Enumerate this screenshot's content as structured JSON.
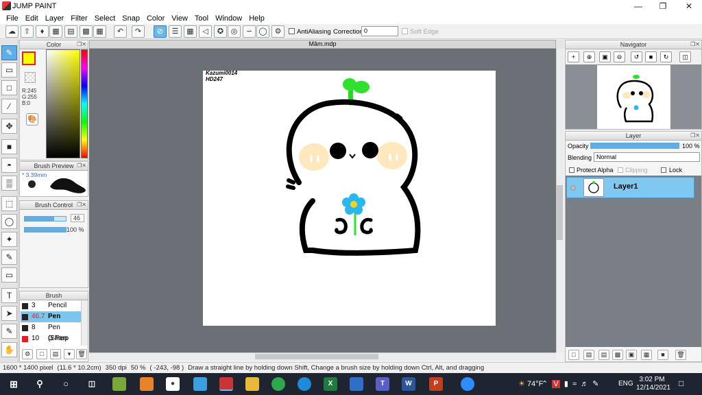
{
  "app": {
    "title": "JUMP PAINT"
  },
  "menu": [
    "File",
    "Edit",
    "Layer",
    "Filter",
    "Select",
    "Snap",
    "Color",
    "View",
    "Tool",
    "Window",
    "Help"
  ],
  "toolbar": {
    "antialiasing_label": "AntiAliasing",
    "correction_label": "Correction",
    "correction_value": "0",
    "soft_edge_label": "Soft Edge"
  },
  "color_panel": {
    "title": "Color",
    "fg_color": "#f5ff00",
    "r": "R:245",
    "g": "G:255",
    "b": "B:0"
  },
  "brush_preview": {
    "title": "Brush Preview",
    "size": "* 3.39mm"
  },
  "brush_control": {
    "title": "Brush Control",
    "size_value": "46",
    "opacity_value": "100 %",
    "size_fraction": 0.72,
    "opacity_fraction": 1.0
  },
  "brush_list": {
    "title": "Brush",
    "items": [
      {
        "size": "3",
        "name": "Pencil",
        "selected": false
      },
      {
        "size": "46.7",
        "name": "Pen",
        "selected": true
      },
      {
        "size": "8",
        "name": "Pen (Sharp",
        "selected": false
      },
      {
        "size": "10",
        "name": "G Pen",
        "selected": false
      }
    ]
  },
  "canvas": {
    "tab_title": "Mâm.mdp",
    "signature_line1": "Kazumi0014",
    "signature_line2": "HD247"
  },
  "navigator": {
    "title": "Navigator"
  },
  "layer_panel": {
    "title": "Layer",
    "opacity_label": "Opacity",
    "opacity_value": "100 %",
    "blending_label": "Blending",
    "blending_value": "Normal",
    "protect_alpha": "Protect Alpha",
    "clipping": "Clipping",
    "lock": "Lock",
    "layers": [
      {
        "name": "Layer1"
      }
    ]
  },
  "status": {
    "size": "1600 * 1400 pixel",
    "size_cm": "(11.6 * 10.2cm)",
    "dpi": "350 dpi",
    "zoom": "50 %",
    "coords": "( -243, -98 )",
    "hint": "Draw a straight line by holding down Shift, Change a brush size by holding down Ctrl, Alt, and dragging"
  },
  "taskbar": {
    "weather": "74°F",
    "language": "ENG",
    "time": "3:02 PM",
    "date": "12/14/2021"
  }
}
